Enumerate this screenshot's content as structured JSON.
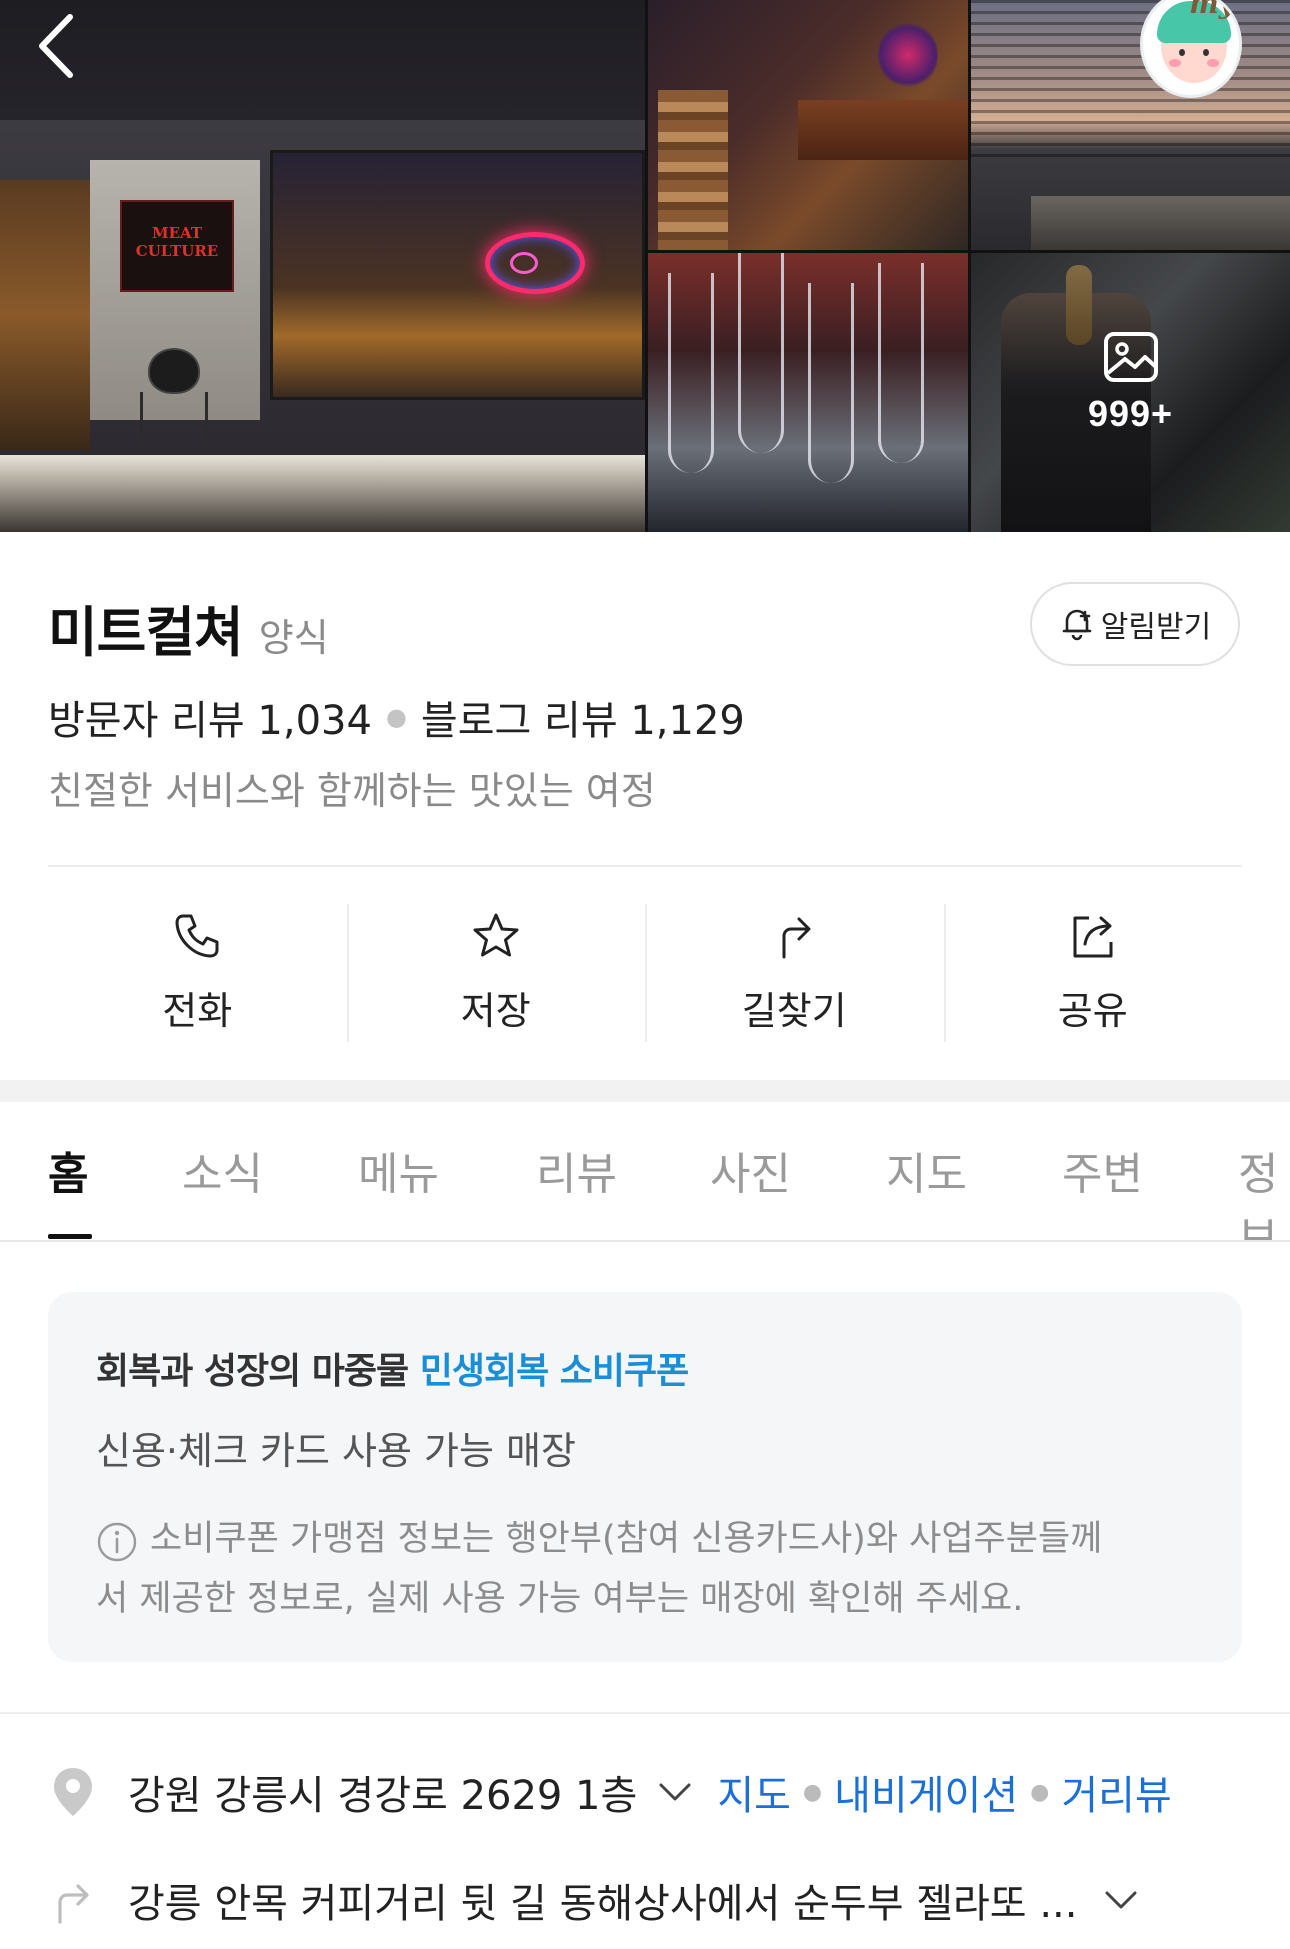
{
  "gallery": {
    "main_sign_text": "MEAT CULTURE",
    "photo_count": "999+"
  },
  "header": {
    "title": "미트컬쳐",
    "category": "양식",
    "alarm_label": "알림받기",
    "visitor_reviews": "방문자 리뷰 1,034",
    "blog_reviews": "블로그 리뷰 1,129",
    "description": "친절한 서비스와 함께하는 맛있는 여정"
  },
  "actions": [
    {
      "label": "전화",
      "icon": "phone-icon"
    },
    {
      "label": "저장",
      "icon": "star-icon"
    },
    {
      "label": "길찾기",
      "icon": "directions-icon"
    },
    {
      "label": "공유",
      "icon": "share-icon"
    }
  ],
  "tabs": [
    "홈",
    "소식",
    "메뉴",
    "리뷰",
    "사진",
    "지도",
    "주변",
    "정보"
  ],
  "active_tab": "홈",
  "coupon": {
    "head_prefix": "회복과 성장의 마중물",
    "head_accent": "민생회복 소비쿠폰",
    "sub": "신용·체크 카드 사용 가능 매장",
    "note_line1": "소비쿠폰 가맹점 정보는 행안부(참여 신용카드사)와 사업주분들께",
    "note_line2": "서 제공한 정보로, 실제 사용 가능 여부는 매장에 확인해 주세요."
  },
  "address": {
    "text": "강원 강릉시 경강로 2629 1층",
    "links": [
      "지도",
      "내비게이션",
      "거리뷰"
    ]
  },
  "directions": {
    "text": "강릉 안목 커피거리 뒷 길 동해상사에서 순두부 젤라또 ..."
  },
  "colors": {
    "accent_blue": "#1a8fd8",
    "link_blue": "#1a6fd8",
    "text_primary": "#111111",
    "text_secondary": "#8a8a8a"
  }
}
